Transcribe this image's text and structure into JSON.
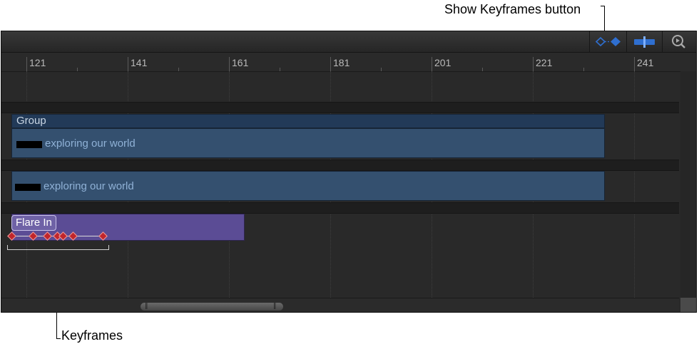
{
  "callouts": {
    "show_keyframes": "Show Keyframes button",
    "keyframes": "Keyframes"
  },
  "toolbar": {
    "buttons": [
      {
        "name": "show-keyframes-button",
        "icon": "keyframes-icon"
      },
      {
        "name": "snapping-button",
        "icon": "snapping-icon"
      },
      {
        "name": "zoom-button",
        "icon": "zoom-icon"
      }
    ]
  },
  "ruler": {
    "labels": [
      "121",
      "141",
      "161",
      "181",
      "201",
      "221",
      "241"
    ]
  },
  "tracks": {
    "group_label": "Group",
    "text_layer_1": "exploring our world",
    "text_layer_2": "exploring our world",
    "behavior_label": "Flare In"
  },
  "colors": {
    "accent_blue": "#2f6fd0",
    "layer_blue": "#34506f",
    "behavior_purple": "#5b4c95",
    "keyframe_red": "#c0262c"
  }
}
